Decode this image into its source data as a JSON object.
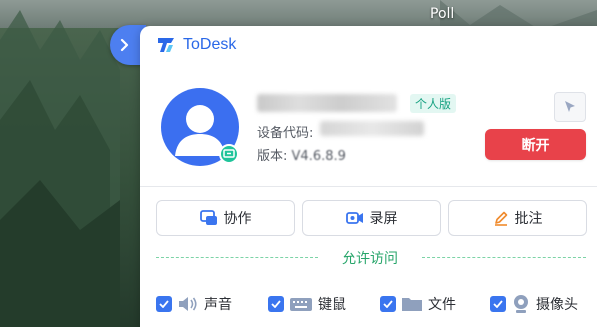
{
  "desktop": {
    "top_label": "Poll"
  },
  "todesk": {
    "brand_name": "ToDesk",
    "account": {
      "edition_tag": "个人版",
      "device_code_label": "设备代码:",
      "version_label": "版本:",
      "version_value": "V4.6.8.9"
    },
    "disconnect_label": "断开",
    "actions": [
      {
        "label": "协作",
        "icon": "collab-icon"
      },
      {
        "label": "录屏",
        "icon": "record-icon"
      },
      {
        "label": "批注",
        "icon": "pen-icon"
      }
    ],
    "allow_access_title": "允许访问",
    "permissions": [
      {
        "label": "声音",
        "icon": "speaker-icon",
        "checked": true
      },
      {
        "label": "键鼠",
        "icon": "keyboard-icon",
        "checked": true
      },
      {
        "label": "文件",
        "icon": "folder-icon",
        "checked": true
      },
      {
        "label": "摄像头",
        "icon": "camera-icon",
        "checked": true
      }
    ]
  },
  "colors": {
    "brand_blue": "#2a68e8",
    "disconnect_red": "#e8424a",
    "access_green": "#27a56a",
    "checkbox_blue": "#3a75ef"
  }
}
